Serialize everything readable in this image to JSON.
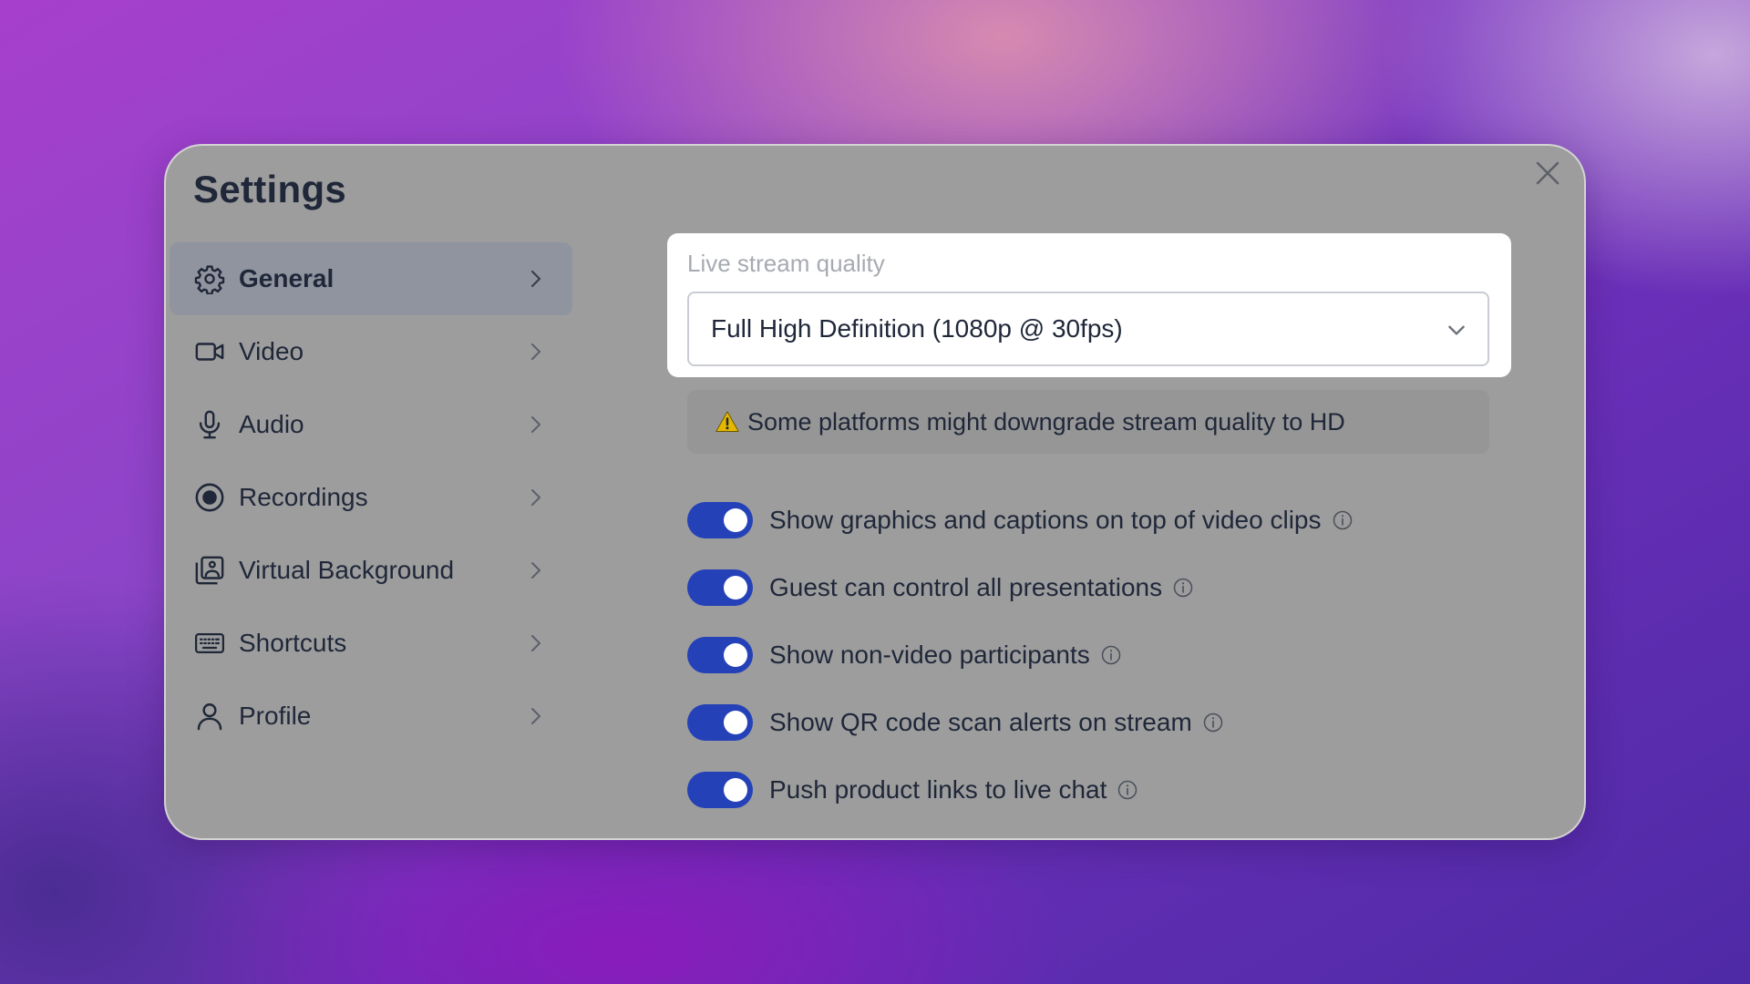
{
  "dialog": {
    "title": "Settings",
    "close_icon": "close-icon"
  },
  "nav": {
    "items": [
      {
        "id": "general",
        "label": "General",
        "icon": "gear-icon",
        "active": true
      },
      {
        "id": "video",
        "label": "Video",
        "icon": "video-camera-icon",
        "active": false
      },
      {
        "id": "audio",
        "label": "Audio",
        "icon": "microphone-icon",
        "active": false
      },
      {
        "id": "recordings",
        "label": "Recordings",
        "icon": "record-icon",
        "active": false
      },
      {
        "id": "virtual-background",
        "label": "Virtual Background",
        "icon": "image-icon",
        "active": false
      },
      {
        "id": "shortcuts",
        "label": "Shortcuts",
        "icon": "keyboard-icon",
        "active": false
      },
      {
        "id": "profile",
        "label": "Profile",
        "icon": "user-icon",
        "active": false
      }
    ]
  },
  "quality": {
    "label": "Live stream quality",
    "selected": "Full High Definition (1080p @ 30fps)"
  },
  "warning": {
    "text": "Some platforms might downgrade stream quality to HD",
    "icon": "warning-icon",
    "icon_color": "#e5b800"
  },
  "toggles": [
    {
      "label": "Show graphics and captions on top of video clips",
      "on": true
    },
    {
      "label": "Guest can control all presentations",
      "on": true
    },
    {
      "label": "Show non-video participants",
      "on": true
    },
    {
      "label": "Show QR code scan alerts on stream",
      "on": true
    },
    {
      "label": "Push product links to live chat",
      "on": true
    }
  ],
  "colors": {
    "accent": "#2441b8",
    "panel": "#9d9d9d",
    "text": "#1f2739"
  }
}
